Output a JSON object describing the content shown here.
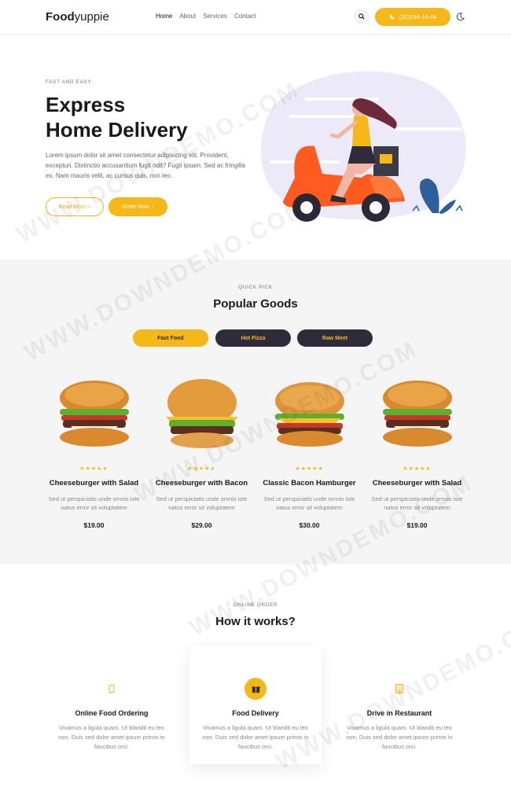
{
  "header": {
    "logo_bold": "Food",
    "logo_light": "yuppie",
    "nav": [
      "Home",
      "About",
      "Services",
      "Contact"
    ],
    "phone": "(32)234-14-84"
  },
  "hero": {
    "eyebrow": "FAST AND EASY",
    "title_line1": "Express",
    "title_line2": "Home Delivery",
    "text": "Lorem ipsum dolor sit amet consectetur adipisicing elit. Provident, excepturi. Distinctio accusantium fugit odit? Fugit ipsam. Sed ac fringilla ex. Nam mauris velit, ac cursus quis, non leo.",
    "read_more": "Read More",
    "order_now": "Order Now"
  },
  "popular": {
    "eyebrow": "QUICK PICK",
    "title": "Popular Goods",
    "tabs": [
      "Fast Food",
      "Hot Pizza",
      "Raw Meet"
    ],
    "products": [
      {
        "name": "Cheeseburger with Salad",
        "desc": "Sed ut perspiciatis unde omnis iste natus error sit voluptatem",
        "price": "$19.00",
        "stars": "★★★★★"
      },
      {
        "name": "Cheeseburger with Bacon",
        "desc": "Sed ut perspiciatis unde omnis iste natus error sit voluptatem",
        "price": "$29.00",
        "stars": "★★★★★"
      },
      {
        "name": "Classic Bacon Hamburger",
        "desc": "Sed ut perspiciatis unde omnis iste natus error sit voluptatem",
        "price": "$30.00",
        "stars": "★★★★★"
      },
      {
        "name": "Cheeseburger with Salad",
        "desc": "Sed ut perspiciatis unde omnis iste natus error sit voluptatem",
        "price": "$19.00",
        "stars": "★★★★★"
      }
    ]
  },
  "how": {
    "eyebrow": "ONLINE ORDER",
    "title": "How it works?",
    "steps": [
      {
        "title": "Online Food Ordering",
        "text": "Vivamus a ligula quam. Ut blandit eu leo non. Duis sed dolor amet ipsum primis in faucibus orci."
      },
      {
        "title": "Food Delivery",
        "text": "Vivamus a ligula quam. Ut blandit eu leo non. Duis sed dolor amet ipsum primis in faucibus orci."
      },
      {
        "title": "Drive in Restaurant",
        "text": "Vivamus a ligula quam. Ut blandit eu leo non. Duis sed dolor amet ipsum primis in faucibus orci."
      }
    ]
  },
  "watermark": "WWW.DOWNDEMO.COM",
  "colors": {
    "accent": "#f6b718",
    "dark": "#2e2c3a",
    "scooter": "#ff5a1f"
  }
}
